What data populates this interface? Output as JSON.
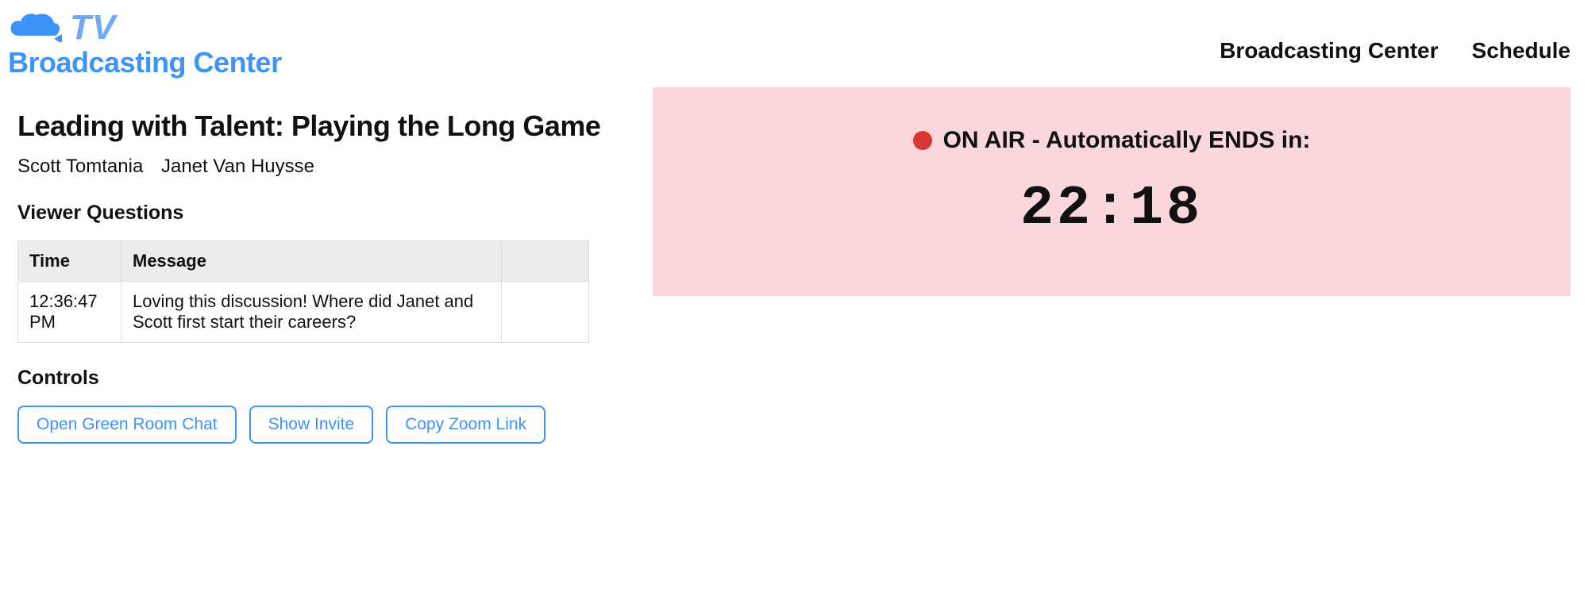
{
  "logo": {
    "tv_text": "TV",
    "subtitle": "Broadcasting Center"
  },
  "nav": {
    "broadcasting_center": "Broadcasting Center",
    "schedule": "Schedule"
  },
  "session": {
    "title": "Leading with Talent: Playing the Long Game",
    "presenters": [
      "Scott Tomtania",
      "Janet Van Huysse"
    ]
  },
  "questions_section": {
    "heading": "Viewer Questions",
    "columns": {
      "time": "Time",
      "message": "Message"
    },
    "rows": [
      {
        "time": "12:36:47 PM",
        "message": "Loving this discussion! Where did Janet and Scott first start their careers?"
      }
    ]
  },
  "controls_section": {
    "heading": "Controls",
    "buttons": {
      "open_green_room": "Open Green Room Chat",
      "show_invite": "Show Invite",
      "copy_zoom": "Copy Zoom Link"
    }
  },
  "onair": {
    "status_label": "ON AIR - Automatically ENDS in:",
    "countdown": "22:18"
  }
}
